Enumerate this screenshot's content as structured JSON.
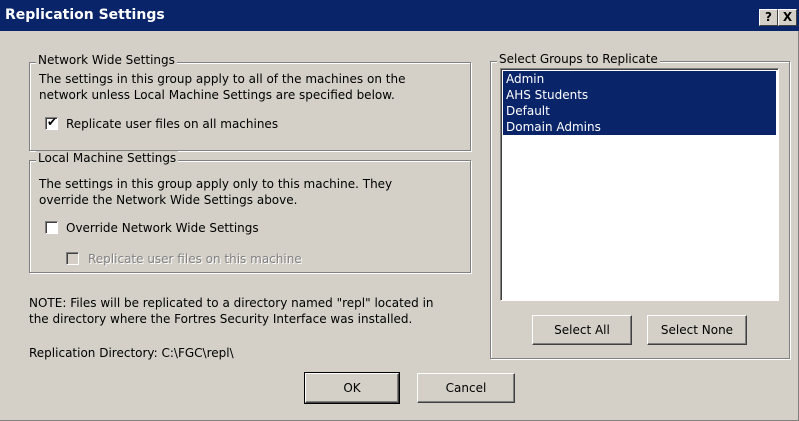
{
  "window": {
    "title": "Replication Settings",
    "help_button": "?",
    "close_button": "X"
  },
  "network_group": {
    "legend": "Network Wide Settings",
    "description_line1": "The settings in this group apply to all of the machines on the",
    "description_line2": "network unless Local Machine Settings are specified below.",
    "checkbox_label": "Replicate user files on all machines",
    "checkbox_checked": true
  },
  "local_group": {
    "legend": "Local Machine Settings",
    "description_line1": "The settings in this group apply only to this machine.  They",
    "description_line2": "override the Network Wide Settings above.",
    "override_label": "Override Network Wide Settings",
    "override_checked": false,
    "replicate_label": "Replicate user files on this machine",
    "replicate_checked": false,
    "replicate_enabled": false
  },
  "note": {
    "line1": "NOTE:  Files will be replicated to a directory named \"repl\" located in",
    "line2": "the directory where the Fortres Security Interface was installed."
  },
  "replication_directory": "Replication Directory: C:\\FGC\\repl\\",
  "groups_panel": {
    "legend": "Select Groups to Replicate",
    "items": [
      "Admin",
      "AHS Students",
      "Default",
      "Domain Admins"
    ],
    "select_all_label": "Select All",
    "select_none_label": "Select None"
  },
  "buttons": {
    "ok_label": "OK",
    "cancel_label": "Cancel"
  },
  "colors": {
    "titlebar": "#0a246a",
    "face": "#d4d0c8",
    "selection": "#0a246a"
  }
}
